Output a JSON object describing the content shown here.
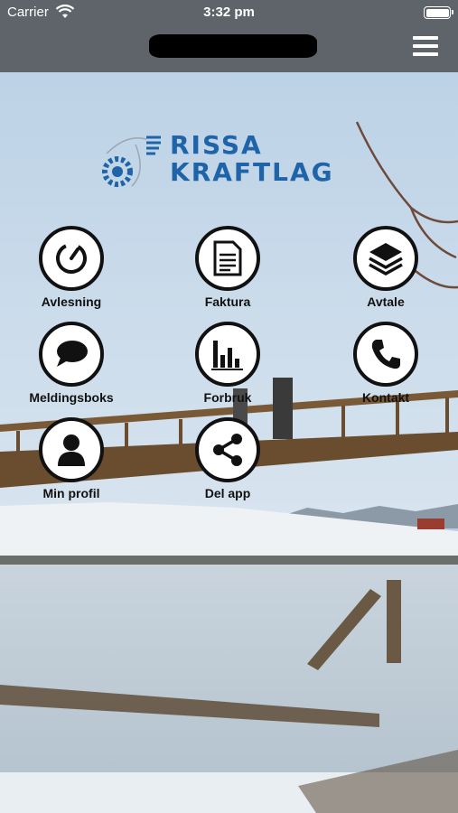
{
  "status": {
    "carrier": "Carrier",
    "time": "3:32 pm"
  },
  "logo": {
    "line1": "RISSA",
    "line2": "KRAFTLAG"
  },
  "menu": {
    "items": [
      {
        "label": "Avlesning",
        "icon": "gauge-icon"
      },
      {
        "label": "Faktura",
        "icon": "document-icon"
      },
      {
        "label": "Avtale",
        "icon": "layers-icon"
      },
      {
        "label": "Meldingsboks",
        "icon": "chat-bubble-icon"
      },
      {
        "label": "Forbruk",
        "icon": "bar-chart-icon"
      },
      {
        "label": "Kontakt",
        "icon": "phone-icon"
      },
      {
        "label": "Min profil",
        "icon": "user-icon"
      },
      {
        "label": "Del app",
        "icon": "share-icon"
      }
    ]
  },
  "colors": {
    "nav": "#5e6469",
    "logo": "#1f63a9"
  }
}
